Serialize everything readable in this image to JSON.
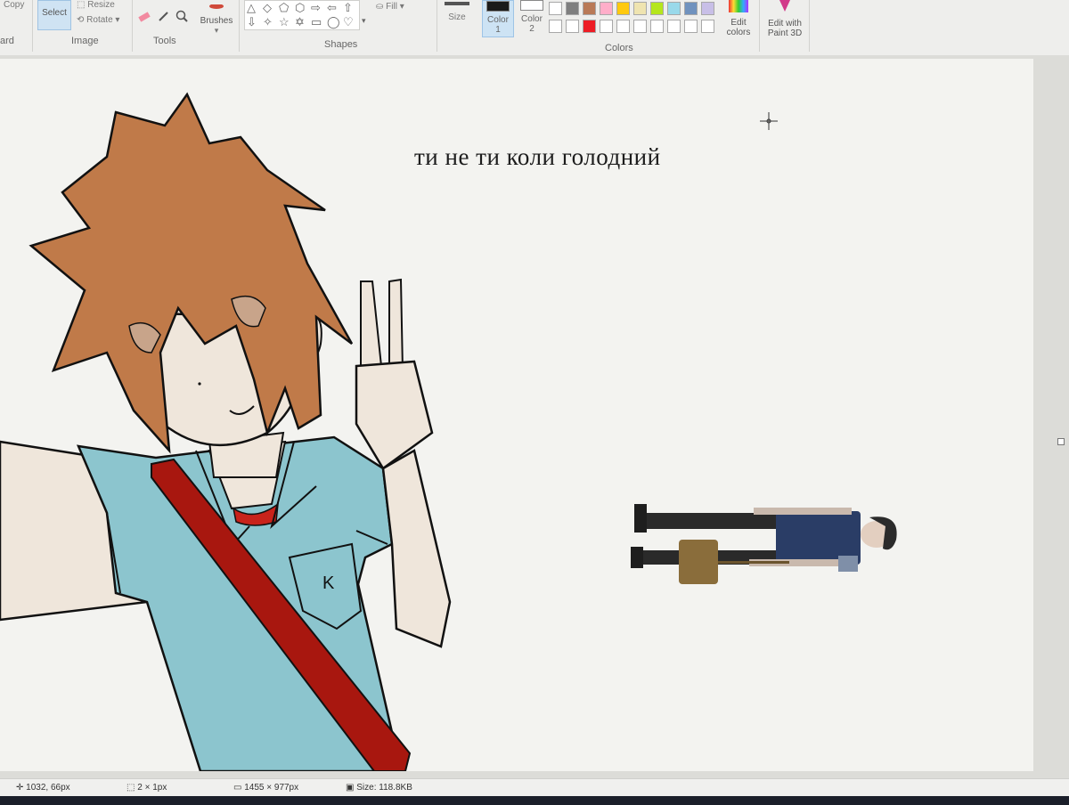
{
  "ribbon": {
    "clipboard": {
      "copy_label": "Copy",
      "group_label": "ard"
    },
    "image": {
      "select_label": "Select",
      "resize_label": "Resize",
      "rotate_label": "Rotate",
      "group_label": "Image"
    },
    "tools": {
      "group_label": "Tools"
    },
    "brushes": {
      "label": "Brushes"
    },
    "shapes": {
      "fill_label": "Fill",
      "group_label": "Shapes"
    },
    "size": {
      "label": "Size"
    },
    "color1": {
      "label_line1": "Color",
      "label_line2": "1",
      "value": "#1a1a1a"
    },
    "color2": {
      "label_line1": "Color",
      "label_line2": "2",
      "value": "#ffffff"
    },
    "palette": {
      "group_label": "Colors",
      "row1": [
        "#ffffff",
        "#7f7f7f",
        "#b97a57",
        "#ffaec9",
        "#ffc90e",
        "#efe4b0",
        "#b5e61d",
        "#99d9ea",
        "#7092be",
        "#c8bfe7"
      ],
      "row2": [
        "#ffffff",
        "#ffffff",
        "#ed1c24",
        "#ffffff",
        "#ffffff",
        "#ffffff",
        "#ffffff",
        "#ffffff",
        "#ffffff",
        "#ffffff"
      ]
    },
    "edit_colors": {
      "line1": "Edit",
      "line2": "colors"
    },
    "edit_paint3d": {
      "line1": "Edit with",
      "line2": "Paint 3D"
    }
  },
  "canvas": {
    "caption": "ти не ти коли голодний",
    "letter_on_pocket": "K"
  },
  "statusbar": {
    "cursor_pos": "1032, 66px",
    "selection_size": "2 × 1px",
    "image_size": "1455 × 977px",
    "file_size": "Size: 118.8KB"
  },
  "colors": {
    "hair": "#c07a49",
    "skin": "#efe6db",
    "shirt": "#8cc5ce",
    "strap": "#a8170f",
    "collar": "#c8231b"
  }
}
